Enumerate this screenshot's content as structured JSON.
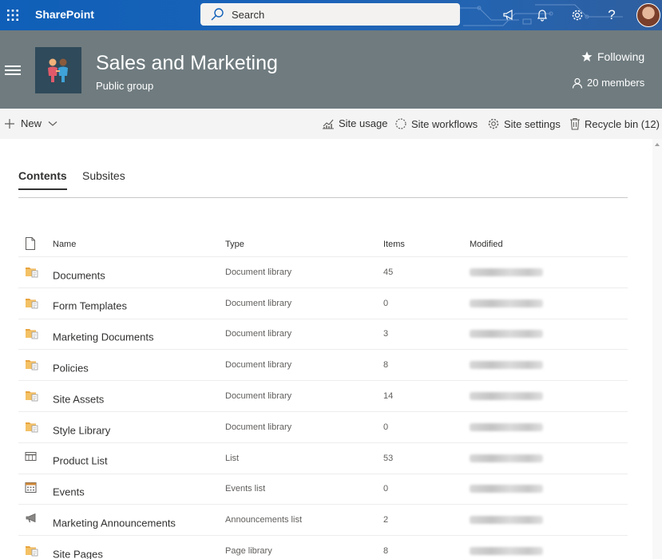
{
  "suite": {
    "brand": "SharePoint",
    "search_placeholder": "Search"
  },
  "site": {
    "title": "Sales and Marketing",
    "subtitle": "Public group",
    "following_label": "Following",
    "members_label": "20 members"
  },
  "command_bar": {
    "new_label": "New",
    "site_usage": "Site usage",
    "site_workflows": "Site workflows",
    "site_settings": "Site settings",
    "recycle_bin": "Recycle bin (12)"
  },
  "tabs": [
    {
      "label": "Contents",
      "active": true
    },
    {
      "label": "Subsites",
      "active": false
    }
  ],
  "table": {
    "columns": {
      "name": "Name",
      "type": "Type",
      "items": "Items",
      "modified": "Modified"
    },
    "rows": [
      {
        "icon": "document-library-icon",
        "name": "Documents",
        "type": "Document library",
        "items": "45"
      },
      {
        "icon": "document-library-icon",
        "name": "Form Templates",
        "type": "Document library",
        "items": "0"
      },
      {
        "icon": "document-library-icon",
        "name": "Marketing Documents",
        "type": "Document library",
        "items": "3"
      },
      {
        "icon": "document-library-icon",
        "name": "Policies",
        "type": "Document library",
        "items": "8"
      },
      {
        "icon": "document-library-icon",
        "name": "Site Assets",
        "type": "Document library",
        "items": "14"
      },
      {
        "icon": "document-library-icon",
        "name": "Style Library",
        "type": "Document library",
        "items": "0"
      },
      {
        "icon": "list-icon",
        "name": "Product List",
        "type": "List",
        "items": "53"
      },
      {
        "icon": "calendar-icon",
        "name": "Events",
        "type": "Events list",
        "items": "0"
      },
      {
        "icon": "megaphone-icon",
        "name": "Marketing Announcements",
        "type": "Announcements list",
        "items": "2"
      },
      {
        "icon": "document-library-icon",
        "name": "Site Pages",
        "type": "Page library",
        "items": "8"
      }
    ]
  },
  "colors": {
    "suite_bar": "#1b63b9",
    "site_header": "#6f7b7f",
    "command_bar": "#f4f4f4",
    "folder": "#e8a33d"
  }
}
